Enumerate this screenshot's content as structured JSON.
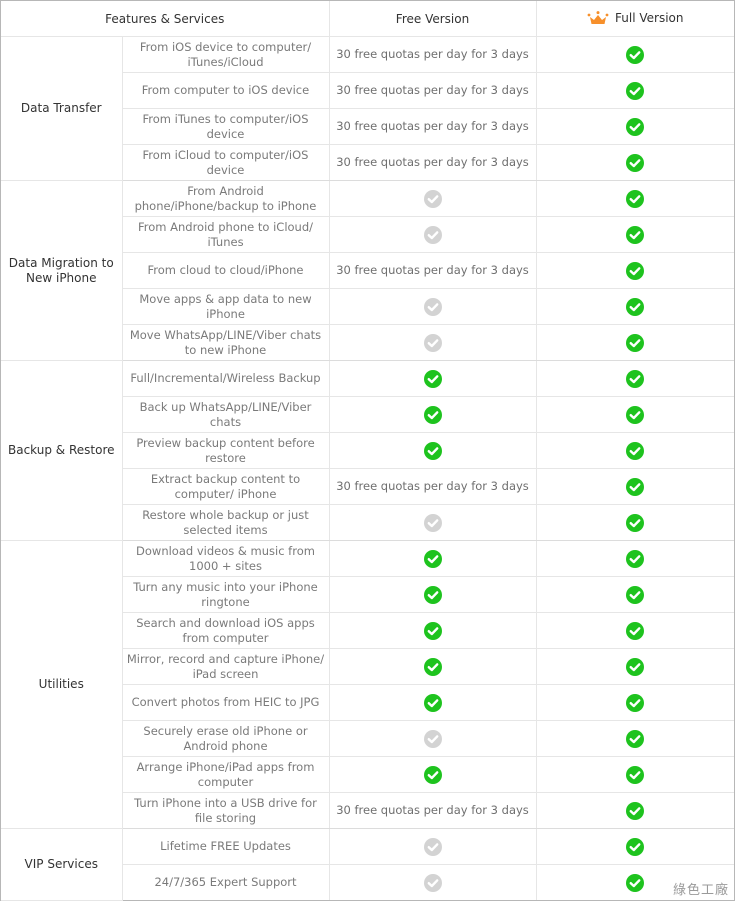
{
  "header": {
    "features_label": "Features & Services",
    "free_label": "Free Version",
    "full_label": "Full Version",
    "full_icon": "crown-icon"
  },
  "colors": {
    "check_green": "#1ec31e",
    "check_gray": "#d3d3d3",
    "crown_orange": "#f7902b"
  },
  "groups": [
    {
      "category": "Data Transfer",
      "rows": [
        {
          "feature": "From iOS device to computer/ iTunes/iCloud",
          "free": "30 free quotas per day for 3 days",
          "full": "check"
        },
        {
          "feature": "From computer to iOS device",
          "free": "30 free quotas per day for 3 days",
          "full": "check"
        },
        {
          "feature": "From iTunes to computer/iOS device",
          "free": "30 free quotas per day for 3 days",
          "full": "check"
        },
        {
          "feature": "From iCloud to computer/iOS device",
          "free": "30 free quotas per day for 3 days",
          "full": "check"
        }
      ]
    },
    {
      "category": "Data Migration to New iPhone",
      "rows": [
        {
          "feature": "From Android phone/iPhone/backup to iPhone",
          "free": "unavailable",
          "full": "check"
        },
        {
          "feature": "From Android phone to iCloud/ iTunes",
          "free": "unavailable",
          "full": "check"
        },
        {
          "feature": "From cloud to cloud/iPhone",
          "free": "30 free quotas per day for 3 days",
          "full": "check"
        },
        {
          "feature": "Move apps & app data to new iPhone",
          "free": "unavailable",
          "full": "check"
        },
        {
          "feature": "Move WhatsApp/LINE/Viber chats to new iPhone",
          "free": "unavailable",
          "full": "check"
        }
      ]
    },
    {
      "category": "Backup & Restore",
      "rows": [
        {
          "feature": "Full/Incremental/Wireless Backup",
          "free": "check",
          "full": "check"
        },
        {
          "feature": "Back up WhatsApp/LINE/Viber chats",
          "free": "check",
          "full": "check"
        },
        {
          "feature": "Preview backup content before restore",
          "free": "check",
          "full": "check"
        },
        {
          "feature": "Extract backup content to computer/ iPhone",
          "free": "30 free quotas per day for 3 days",
          "full": "check"
        },
        {
          "feature": "Restore whole backup or just selected items",
          "free": "unavailable",
          "full": "check"
        }
      ]
    },
    {
      "category": "Utilities",
      "rows": [
        {
          "feature": "Download videos & music from 1000 + sites",
          "free": "check",
          "full": "check"
        },
        {
          "feature": "Turn any music into your iPhone ringtone",
          "free": "check",
          "full": "check"
        },
        {
          "feature": "Search and download iOS apps from computer",
          "free": "check",
          "full": "check"
        },
        {
          "feature": "Mirror, record and capture iPhone/ iPad screen",
          "free": "check",
          "full": "check"
        },
        {
          "feature": "Convert photos from HEIC to JPG",
          "free": "check",
          "full": "check"
        },
        {
          "feature": "Securely erase old iPhone or Android phone",
          "free": "unavailable",
          "full": "check"
        },
        {
          "feature": "Arrange iPhone/iPad apps from computer",
          "free": "check",
          "full": "check"
        },
        {
          "feature": "Turn iPhone into a USB drive for file storing",
          "free": "30 free quotas per day for 3 days",
          "full": "check"
        }
      ]
    },
    {
      "category": "VIP Services",
      "rows": [
        {
          "feature": "Lifetime FREE Updates",
          "free": "unavailable",
          "full": "check"
        },
        {
          "feature": "24/7/365 Expert Support",
          "free": "unavailable",
          "full": "check"
        }
      ]
    }
  ],
  "watermark": "綠色工廠"
}
